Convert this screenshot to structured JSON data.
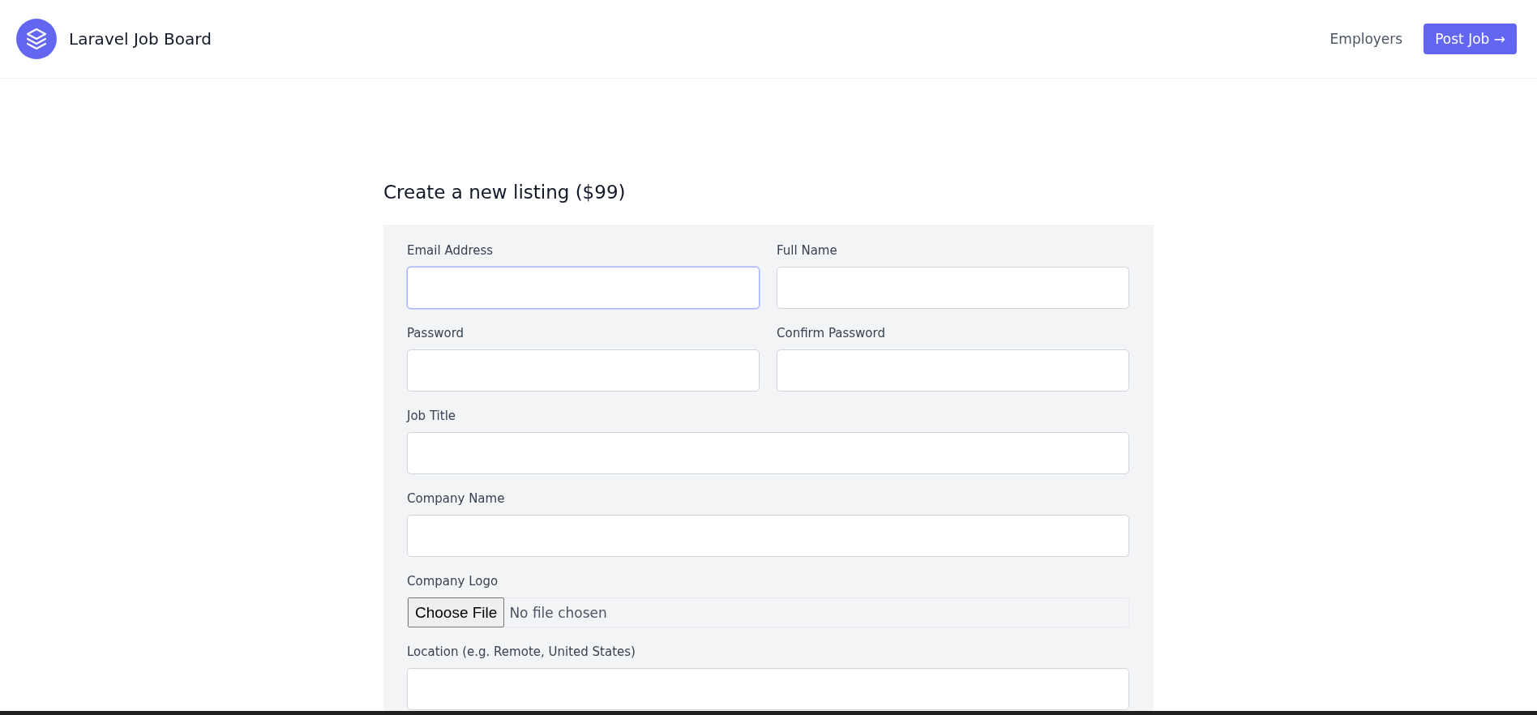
{
  "header": {
    "brand": "Laravel Job Board",
    "nav_link": "Employers",
    "post_button": "Post Job →"
  },
  "page_title": "Create a new listing ($99)",
  "form": {
    "rows": [
      {
        "fields": [
          {
            "kind": "text",
            "label": "Email Address",
            "focused": true
          },
          {
            "kind": "text",
            "label": "Full Name",
            "focused": false
          }
        ]
      },
      {
        "fields": [
          {
            "kind": "text",
            "label": "Password",
            "focused": false
          },
          {
            "kind": "text",
            "label": "Confirm Password",
            "focused": false
          }
        ]
      },
      {
        "fields": [
          {
            "kind": "text",
            "label": "Job Title",
            "focused": false
          }
        ]
      },
      {
        "fields": [
          {
            "kind": "text",
            "label": "Company Name",
            "focused": false
          }
        ]
      },
      {
        "fields": [
          {
            "kind": "file",
            "label": "Company Logo",
            "button": "Choose File",
            "status": "No file chosen",
            "focused": false
          }
        ]
      },
      {
        "fields": [
          {
            "kind": "text",
            "label": "Location (e.g. Remote, United States)",
            "focused": false
          }
        ]
      }
    ]
  }
}
